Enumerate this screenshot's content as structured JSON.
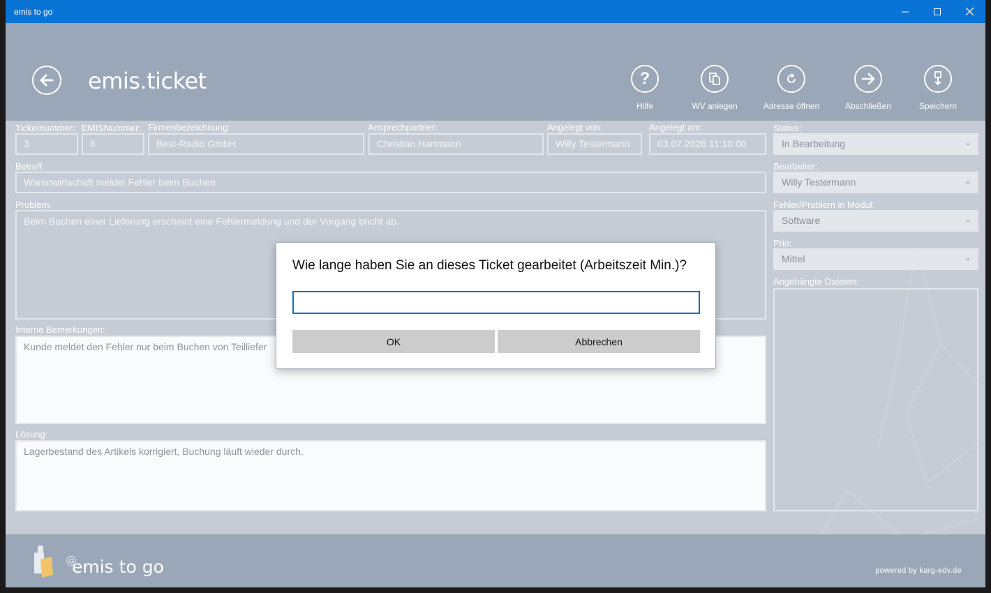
{
  "window": {
    "title": "emis to go"
  },
  "header": {
    "app_title": "emis.ticket",
    "toolbar": {
      "help": "Hilfe",
      "wv": "WV anlegen",
      "address": "Adresse öffnen",
      "close_ticket": "Abschließen",
      "save": "Speichern"
    }
  },
  "form": {
    "ticket_no": {
      "label": "Ticketnummer:",
      "value": "3"
    },
    "emis_no": {
      "label": "EMISNummer:",
      "value": "8"
    },
    "company": {
      "label": "Firmenbezeichnung:",
      "value": "Best-Radio GmbH"
    },
    "contact": {
      "label": "Ansprechpartner:",
      "value": "Christian Hartmann"
    },
    "created_by": {
      "label": "Angelegt von:",
      "value": "Willy Testermann"
    },
    "created_on": {
      "label": "Angelegt am:",
      "value": "03.07.2026 11:10:00"
    },
    "subject": {
      "label": "Betreff:",
      "value": "Warenwirtschaft meldet Fehler beim Buchen"
    },
    "problem": {
      "label": "Problem:",
      "value": "Beim Buchen einer Lieferung erscheint eine Fehlermeldung und der Vorgang bricht ab."
    },
    "internal": {
      "label": "Interne Bemerkungen:",
      "value": "Kunde meldet den Fehler nur beim Buchen von Teilliefer"
    },
    "solution": {
      "label": "Lösung:",
      "value": "Lagerbestand des Artikels korrigiert, Buchung läuft wieder durch."
    }
  },
  "side": {
    "status": {
      "label": "Status:",
      "value": "In Bearbeitung"
    },
    "editor": {
      "label": "Bearbeiter:",
      "value": "Willy Testermann"
    },
    "module": {
      "label": "Fehler/Problem in Modul:",
      "value": "Software"
    },
    "prio": {
      "label": "Prio:",
      "value": "Mittel"
    },
    "attachments": {
      "label": "Angehängte Dateien:"
    }
  },
  "footer": {
    "brand": "emis to go",
    "powered": "powered by karg-edv.de"
  },
  "dialog": {
    "question": "Wie lange haben Sie an dieses Ticket gearbeitet (Arbeitszeit Min.)?",
    "input_value": "",
    "ok": "OK",
    "cancel": "Abbrechen"
  }
}
